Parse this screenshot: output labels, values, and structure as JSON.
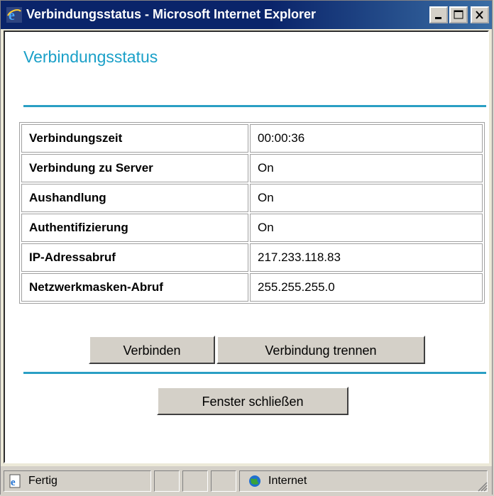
{
  "window": {
    "title": "Verbindungsstatus - Microsoft Internet Explorer"
  },
  "page": {
    "title": "Verbindungsstatus"
  },
  "status_table": [
    {
      "label": "Verbindungszeit",
      "value": "00:00:36"
    },
    {
      "label": "Verbindung zu Server",
      "value": "On"
    },
    {
      "label": "Aushandlung",
      "value": "On"
    },
    {
      "label": "Authentifizierung",
      "value": "On"
    },
    {
      "label": "IP-Adressabruf",
      "value": "217.233.118.83"
    },
    {
      "label": "Netzwerkmasken-Abruf",
      "value": "255.255.255.0"
    }
  ],
  "buttons": {
    "connect": "Verbinden",
    "disconnect": "Verbindung trennen",
    "close_window": "Fenster schließen"
  },
  "statusbar": {
    "status": "Fertig",
    "zone": "Internet"
  },
  "colors": {
    "title_accent": "#1aa0c8",
    "titlebar": "#0a246a"
  }
}
